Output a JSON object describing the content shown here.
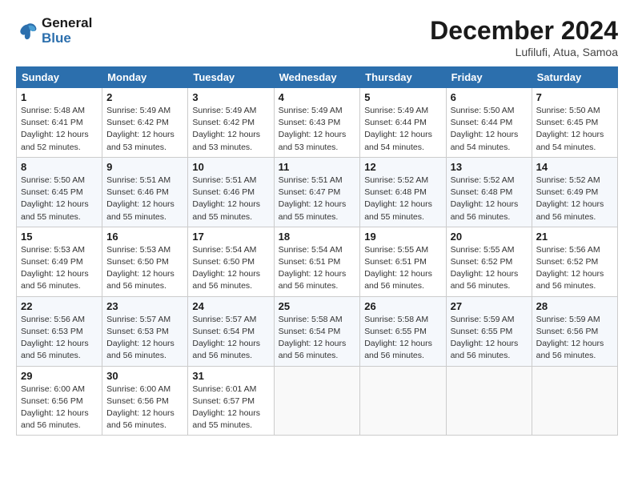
{
  "header": {
    "logo_line1": "General",
    "logo_line2": "Blue",
    "month": "December 2024",
    "location": "Lufilufi, Atua, Samoa"
  },
  "days_of_week": [
    "Sunday",
    "Monday",
    "Tuesday",
    "Wednesday",
    "Thursday",
    "Friday",
    "Saturday"
  ],
  "weeks": [
    [
      {
        "day": 1,
        "sunrise": "5:48 AM",
        "sunset": "6:41 PM",
        "daylight": "12 hours and 52 minutes."
      },
      {
        "day": 2,
        "sunrise": "5:49 AM",
        "sunset": "6:42 PM",
        "daylight": "12 hours and 53 minutes."
      },
      {
        "day": 3,
        "sunrise": "5:49 AM",
        "sunset": "6:42 PM",
        "daylight": "12 hours and 53 minutes."
      },
      {
        "day": 4,
        "sunrise": "5:49 AM",
        "sunset": "6:43 PM",
        "daylight": "12 hours and 53 minutes."
      },
      {
        "day": 5,
        "sunrise": "5:49 AM",
        "sunset": "6:44 PM",
        "daylight": "12 hours and 54 minutes."
      },
      {
        "day": 6,
        "sunrise": "5:50 AM",
        "sunset": "6:44 PM",
        "daylight": "12 hours and 54 minutes."
      },
      {
        "day": 7,
        "sunrise": "5:50 AM",
        "sunset": "6:45 PM",
        "daylight": "12 hours and 54 minutes."
      }
    ],
    [
      {
        "day": 8,
        "sunrise": "5:50 AM",
        "sunset": "6:45 PM",
        "daylight": "12 hours and 55 minutes."
      },
      {
        "day": 9,
        "sunrise": "5:51 AM",
        "sunset": "6:46 PM",
        "daylight": "12 hours and 55 minutes."
      },
      {
        "day": 10,
        "sunrise": "5:51 AM",
        "sunset": "6:46 PM",
        "daylight": "12 hours and 55 minutes."
      },
      {
        "day": 11,
        "sunrise": "5:51 AM",
        "sunset": "6:47 PM",
        "daylight": "12 hours and 55 minutes."
      },
      {
        "day": 12,
        "sunrise": "5:52 AM",
        "sunset": "6:48 PM",
        "daylight": "12 hours and 55 minutes."
      },
      {
        "day": 13,
        "sunrise": "5:52 AM",
        "sunset": "6:48 PM",
        "daylight": "12 hours and 56 minutes."
      },
      {
        "day": 14,
        "sunrise": "5:52 AM",
        "sunset": "6:49 PM",
        "daylight": "12 hours and 56 minutes."
      }
    ],
    [
      {
        "day": 15,
        "sunrise": "5:53 AM",
        "sunset": "6:49 PM",
        "daylight": "12 hours and 56 minutes."
      },
      {
        "day": 16,
        "sunrise": "5:53 AM",
        "sunset": "6:50 PM",
        "daylight": "12 hours and 56 minutes."
      },
      {
        "day": 17,
        "sunrise": "5:54 AM",
        "sunset": "6:50 PM",
        "daylight": "12 hours and 56 minutes."
      },
      {
        "day": 18,
        "sunrise": "5:54 AM",
        "sunset": "6:51 PM",
        "daylight": "12 hours and 56 minutes."
      },
      {
        "day": 19,
        "sunrise": "5:55 AM",
        "sunset": "6:51 PM",
        "daylight": "12 hours and 56 minutes."
      },
      {
        "day": 20,
        "sunrise": "5:55 AM",
        "sunset": "6:52 PM",
        "daylight": "12 hours and 56 minutes."
      },
      {
        "day": 21,
        "sunrise": "5:56 AM",
        "sunset": "6:52 PM",
        "daylight": "12 hours and 56 minutes."
      }
    ],
    [
      {
        "day": 22,
        "sunrise": "5:56 AM",
        "sunset": "6:53 PM",
        "daylight": "12 hours and 56 minutes."
      },
      {
        "day": 23,
        "sunrise": "5:57 AM",
        "sunset": "6:53 PM",
        "daylight": "12 hours and 56 minutes."
      },
      {
        "day": 24,
        "sunrise": "5:57 AM",
        "sunset": "6:54 PM",
        "daylight": "12 hours and 56 minutes."
      },
      {
        "day": 25,
        "sunrise": "5:58 AM",
        "sunset": "6:54 PM",
        "daylight": "12 hours and 56 minutes."
      },
      {
        "day": 26,
        "sunrise": "5:58 AM",
        "sunset": "6:55 PM",
        "daylight": "12 hours and 56 minutes."
      },
      {
        "day": 27,
        "sunrise": "5:59 AM",
        "sunset": "6:55 PM",
        "daylight": "12 hours and 56 minutes."
      },
      {
        "day": 28,
        "sunrise": "5:59 AM",
        "sunset": "6:56 PM",
        "daylight": "12 hours and 56 minutes."
      }
    ],
    [
      {
        "day": 29,
        "sunrise": "6:00 AM",
        "sunset": "6:56 PM",
        "daylight": "12 hours and 56 minutes."
      },
      {
        "day": 30,
        "sunrise": "6:00 AM",
        "sunset": "6:56 PM",
        "daylight": "12 hours and 56 minutes."
      },
      {
        "day": 31,
        "sunrise": "6:01 AM",
        "sunset": "6:57 PM",
        "daylight": "12 hours and 55 minutes."
      },
      null,
      null,
      null,
      null
    ]
  ]
}
